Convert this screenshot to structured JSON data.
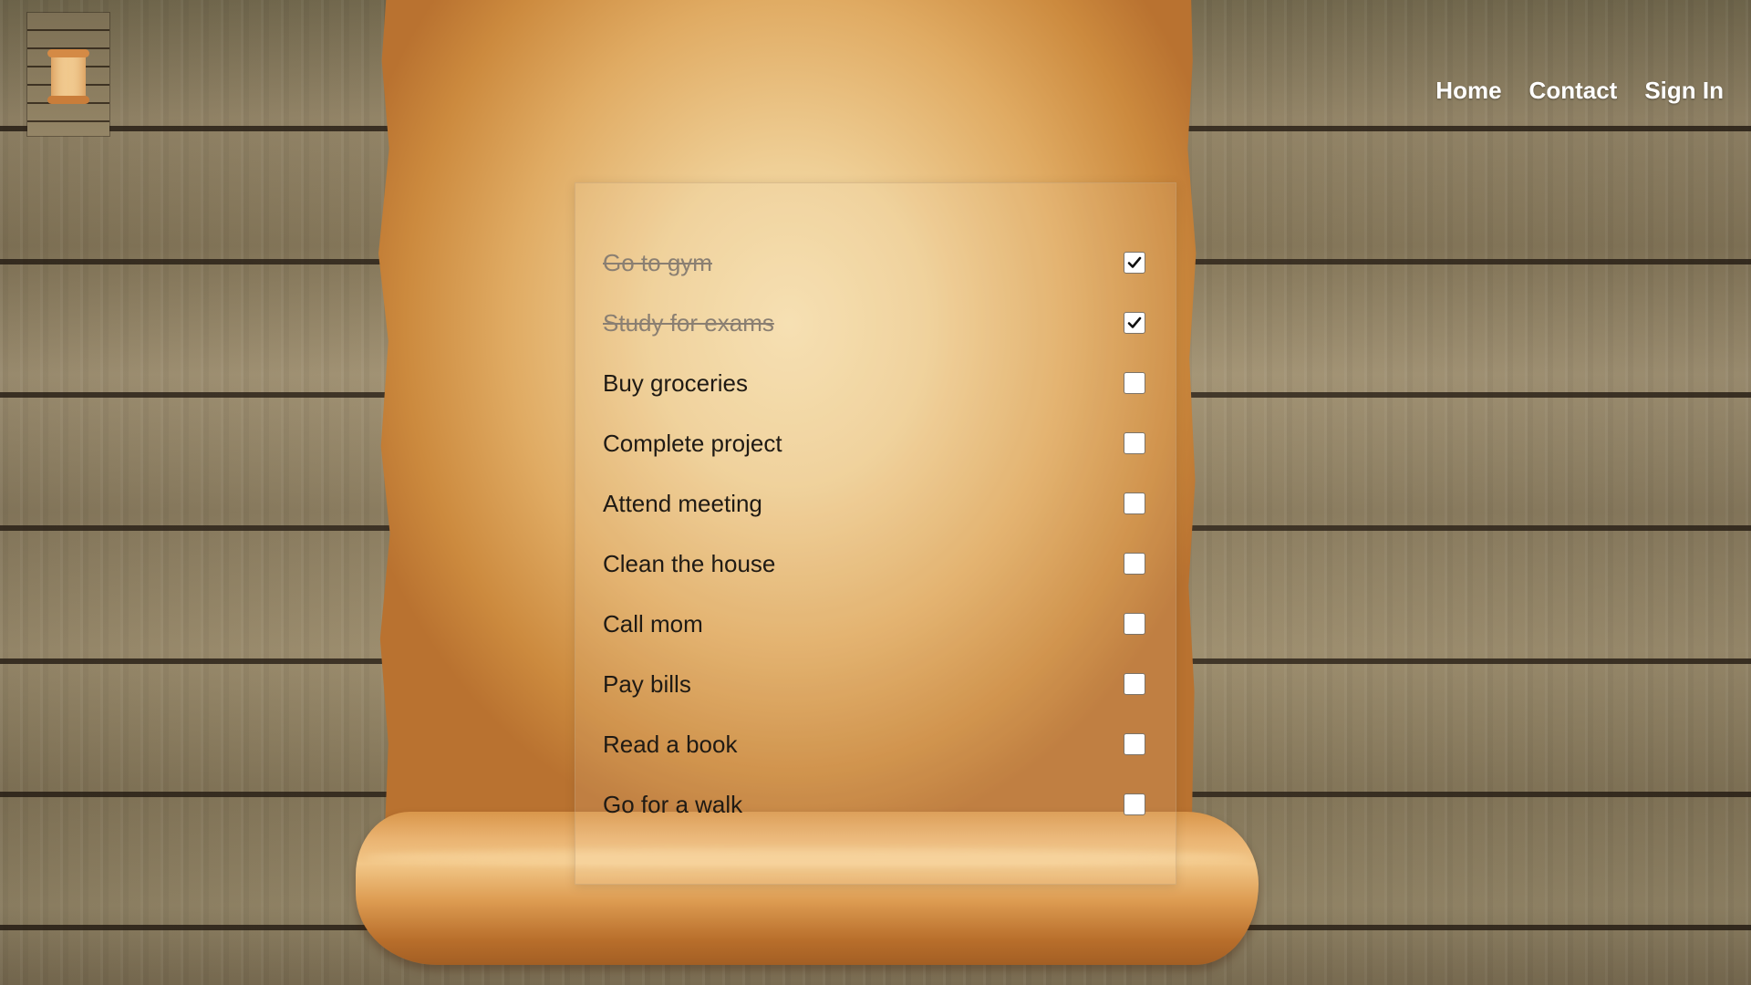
{
  "nav": {
    "items": [
      {
        "label": "Home"
      },
      {
        "label": "Contact"
      },
      {
        "label": "Sign In"
      }
    ]
  },
  "logo": {
    "icon": "scroll-icon"
  },
  "todos": [
    {
      "text": "Go to gym",
      "done": true
    },
    {
      "text": "Study for exams",
      "done": true
    },
    {
      "text": "Buy groceries",
      "done": false
    },
    {
      "text": "Complete project",
      "done": false
    },
    {
      "text": "Attend meeting",
      "done": false
    },
    {
      "text": "Clean the house",
      "done": false
    },
    {
      "text": "Call mom",
      "done": false
    },
    {
      "text": "Pay bills",
      "done": false
    },
    {
      "text": "Read a book",
      "done": false
    },
    {
      "text": "Go for a walk",
      "done": false
    }
  ],
  "colors": {
    "parchment": "#efcf96",
    "parchment_edge": "#cc8a3e",
    "wood": "#8f8060",
    "nav_text": "#ffffff",
    "done_text": "#8a7f72"
  }
}
